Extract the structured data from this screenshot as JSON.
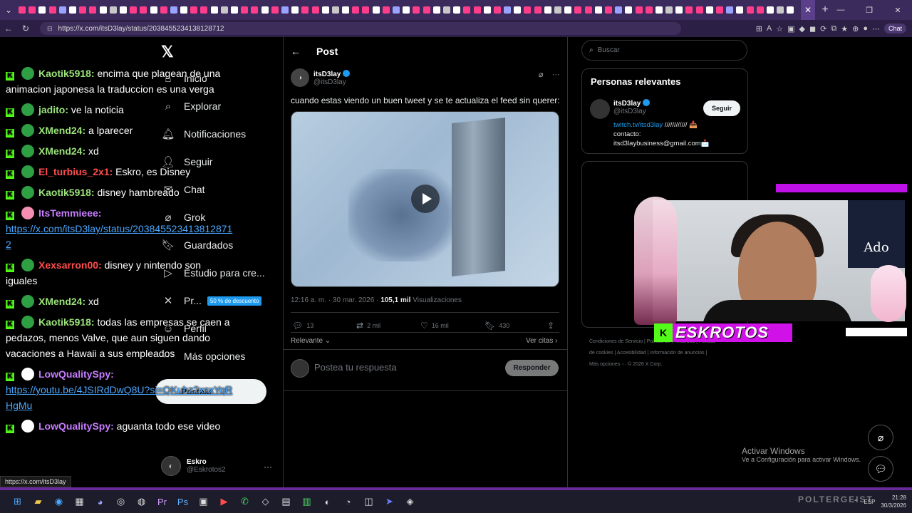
{
  "browser": {
    "url": "https://x.com/itsD3lay/status/2038455234138128712",
    "chat_button": "Chat",
    "status_url": "https://x.com/itsD3lay"
  },
  "nav": {
    "items": [
      {
        "label": "Inicio",
        "icon": "home-icon"
      },
      {
        "label": "Explorar",
        "icon": "search-icon"
      },
      {
        "label": "Notificaciones",
        "icon": "bell-icon"
      },
      {
        "label": "Seguir",
        "icon": "follow-icon"
      },
      {
        "label": "Chat",
        "icon": "chat-icon"
      },
      {
        "label": "Grok",
        "icon": "grok-icon"
      },
      {
        "label": "Guardados",
        "icon": "bookmark-icon"
      },
      {
        "label": "Estudio para cre...",
        "icon": "studio-icon"
      },
      {
        "label": "Pr...",
        "icon": "x-premium-icon"
      },
      {
        "label": "Perfil",
        "icon": "person-icon"
      },
      {
        "label": "Más opciones",
        "icon": "more-icon"
      }
    ],
    "promo": "50 % de descuento",
    "post_button": "Postear",
    "profile": {
      "name": "Eskro",
      "handle": "@Eskrotos2"
    }
  },
  "chat": [
    {
      "user": "Kaotik5918:",
      "color": "#9be37a",
      "badge": "#2ea043",
      "text": " encima que plagean de una animacion japonesa la traduccion es una verga"
    },
    {
      "user": "jadito:",
      "color": "#9be37a",
      "badge": "#2ea043",
      "text": " ve la noticia"
    },
    {
      "user": "XMend24:",
      "color": "#9be37a",
      "badge": "#2ea043",
      "text": " a lparecer"
    },
    {
      "user": "XMend24:",
      "color": "#9be37a",
      "badge": "#2ea043",
      "text": " xd"
    },
    {
      "user": "El_turbius_2x1:",
      "color": "#ff4d4d",
      "badge": "#2ea043",
      "text": " Eskro, es Disney"
    },
    {
      "user": "Kaotik5918:",
      "color": "#9be37a",
      "badge": "#2ea043",
      "text": " disney hambreado"
    },
    {
      "user": "ItsTemmieee:",
      "color": "#c77dff",
      "badge": "#f48fb1",
      "text": "",
      "link": "https://x.com/itsD3lay/status/2038455234138128712"
    },
    {
      "user": "Xexsarron00:",
      "color": "#ff4d4d",
      "badge": "#2ea043",
      "text": " disney y nintendo son iguales"
    },
    {
      "user": "XMend24:",
      "color": "#9be37a",
      "badge": "#2ea043",
      "text": " xd"
    },
    {
      "user": "Kaotik5918:",
      "color": "#9be37a",
      "badge": "#2ea043",
      "text": " todas las empresas se caen a pedazos, menos Valve, que aun siguen dando vacaciones a Hawaii a sus empleados"
    },
    {
      "user": "LowQualitySpy:",
      "color": "#c77dff",
      "badge": "#ffffff",
      "text": "",
      "link": "https://youtu.be/4JSIRdDwQ8U?si=QKuhz2xsxYqRHgMu"
    },
    {
      "user": "LowQualitySpy:",
      "color": "#c77dff",
      "badge": "#ffffff",
      "text": " aguanta todo ese video"
    }
  ],
  "post": {
    "header": "Post",
    "author_name": "itsD3lay",
    "author_handle": "@itsD3lay",
    "text": "cuando estas viendo un buen tweet y se te actualiza el feed sin querer:",
    "time": "12:16 a. m. · 30 mar. 2026 · ",
    "views_count": "105,1 mil",
    "views_label": " Visualizaciones",
    "replies": "13",
    "reposts": "2 mil",
    "likes": "16 mil",
    "bookmarks": "430",
    "sort": "Relevante",
    "quotes": "Ver citas",
    "reply_placeholder": "Postea tu respuesta",
    "reply_button": "Responder"
  },
  "sidebar": {
    "search_placeholder": "Buscar",
    "relevant_title": "Personas relevantes",
    "person_name": "itsD3lay",
    "person_handle": "@itsD3lay",
    "follow": "Seguir",
    "bio_link": "twitch.tv/itsd3lay",
    "bio_rest": " //////////// 📥",
    "bio_line2": "contacto:",
    "bio_line3": "itsd3laybusiness@gmail.com📩",
    "footer": "Condiciones de Servicio | Política de Privacidad | Política de cookies | Accesibilidad | Información de anuncios | Más opciones ··· © 2026 X Corp."
  },
  "overlay": {
    "streamer_name": "ESKROTOS",
    "poster_text": "Ado",
    "activate_title": "Activar Windows",
    "activate_sub": "Ve a Configuración para activar Windows."
  },
  "taskbar": {
    "lang": "ESP",
    "time": "21:28",
    "date": "30/3/2026",
    "watermark": "POLTERGEIST"
  }
}
